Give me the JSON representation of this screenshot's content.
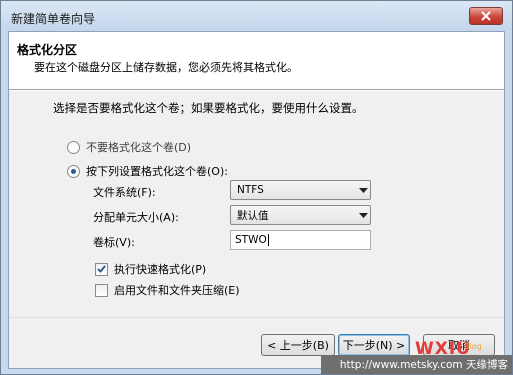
{
  "window": {
    "title": "新建简单卷向导"
  },
  "header": {
    "title": "格式化分区",
    "subtitle": "要在这个磁盘分区上储存数据，您必须先将其格式化。"
  },
  "instruction": "选择是否要格式化这个卷；如果要格式化，要使用什么设置。",
  "options": {
    "no_format": {
      "label": "不要格式化这个卷(D)",
      "checked": false
    },
    "format": {
      "label": "按下列设置格式化这个卷(O):",
      "checked": true
    }
  },
  "fields": {
    "filesystem": {
      "label": "文件系统(F):",
      "value": "NTFS"
    },
    "allocation": {
      "label": "分配单元大小(A):",
      "value": "默认值"
    },
    "volume_label": {
      "label": "卷标(V):",
      "value": "STWO"
    }
  },
  "checks": {
    "quick_format": {
      "label": "执行快速格式化(P)",
      "checked": true
    },
    "compression": {
      "label": "启用文件和文件夹压缩(E)",
      "checked": false
    }
  },
  "buttons": {
    "back": "< 上一步(B)",
    "next": "下一步(N) >",
    "cancel": "取消"
  },
  "watermark": {
    "logo": "WXIU",
    "tag": "Blog",
    "text": "http://www.metsky.com 天缘博客"
  }
}
